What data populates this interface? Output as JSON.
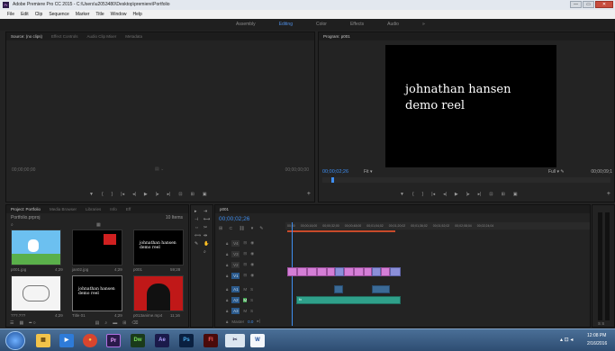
{
  "window": {
    "title": "Adobe Premiere Pro CC 2015 - C:\\Users\\u2053480\\Desktop\\premiere\\Portfolio",
    "app_icon": "Pr",
    "min": "—",
    "max": "▭",
    "close": "✕"
  },
  "menu": [
    "File",
    "Edit",
    "Clip",
    "Sequence",
    "Marker",
    "Title",
    "Window",
    "Help"
  ],
  "workspaces": {
    "items": [
      "Assembly",
      "Editing",
      "Color",
      "Effects",
      "Audio"
    ],
    "active": "Editing",
    "more": "»"
  },
  "source_panel": {
    "tabs": [
      "Source: (no clips)",
      "Effect Controls",
      "Audio Clip Mixer",
      "Metadata"
    ],
    "timecode_left": "00;00;00;00",
    "timecode_right": "00;00;00;00"
  },
  "program_panel": {
    "tab": "Program: p001",
    "overlay_text_line1": "johnathan hansen",
    "overlay_text_line2": "demo reel",
    "timecode": "00;00;02;26",
    "fit": "Fit",
    "quality": "Full",
    "duration": "00;00;09;1"
  },
  "project_panel": {
    "tabs": [
      "Project: Portfolio",
      "Media Browser",
      "Libraries",
      "Info",
      "Eff"
    ],
    "file": "Portfolio.prproj",
    "item_count": "10 Items",
    "items": [
      {
        "name": "p001.jpg",
        "dur": "4;29"
      },
      {
        "name": "jan02.jpg",
        "dur": "4;29"
      },
      {
        "name": "p001",
        "dur": "59;28"
      },
      {
        "name": "???.???",
        "dur": "4;29"
      },
      {
        "name": "Title 01",
        "dur": "4;29"
      },
      {
        "name": "p013anime.mp4",
        "dur": "11;16"
      }
    ],
    "title_thumb_text": "johnathan hansen demo reel"
  },
  "timeline": {
    "tab": "p001",
    "timecode": "00;00;02;26",
    "ruler": [
      "00;00",
      "00;00;16;00",
      "00;00;32;00",
      "00;00;48;00",
      "00;01;04;02",
      "00;01;20;02",
      "00;01;36;02",
      "00;01;52;02",
      "00;02;08;04",
      "00;02;24;04",
      "00"
    ],
    "video_tracks": [
      "V4",
      "V3",
      "V2",
      "V1"
    ],
    "audio_tracks": [
      "A1",
      "A2",
      "A3"
    ],
    "master": "Master",
    "master_value": "0.0",
    "audio_clip_label": "fx"
  },
  "taskbar": {
    "apps": [
      "Pr",
      "Dw",
      "Ae",
      "Ps",
      "Fl",
      "W"
    ],
    "time": "12:08 PM",
    "date": "2/16/2016"
  },
  "colors": {
    "accent": "#4f8fe6",
    "video_clip": "#d47ed6",
    "audio_clip": "#2f7e8c",
    "selected_clip": "#8b8fd8"
  }
}
